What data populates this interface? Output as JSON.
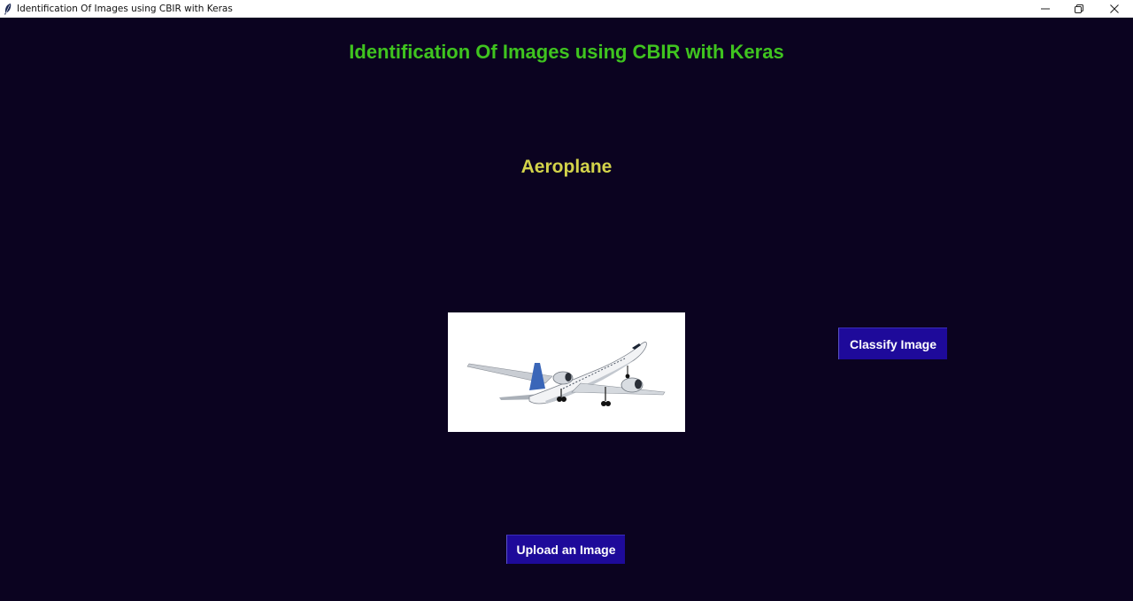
{
  "window": {
    "title": "Identification Of Images using CBIR with Keras",
    "controls": [
      "minimize-icon",
      "restore-icon",
      "close-icon"
    ]
  },
  "main": {
    "heading": "Identification Of Images using CBIR with Keras",
    "prediction": "Aeroplane",
    "preview_image": "airplane-image",
    "classify_label": "Classify Image",
    "upload_label": "Upload an Image"
  },
  "colors": {
    "background": "#0b0320",
    "heading": "#3fc41f",
    "prediction": "#d3d34a",
    "button": "#1e0a9a",
    "button_text": "#ffffff"
  }
}
